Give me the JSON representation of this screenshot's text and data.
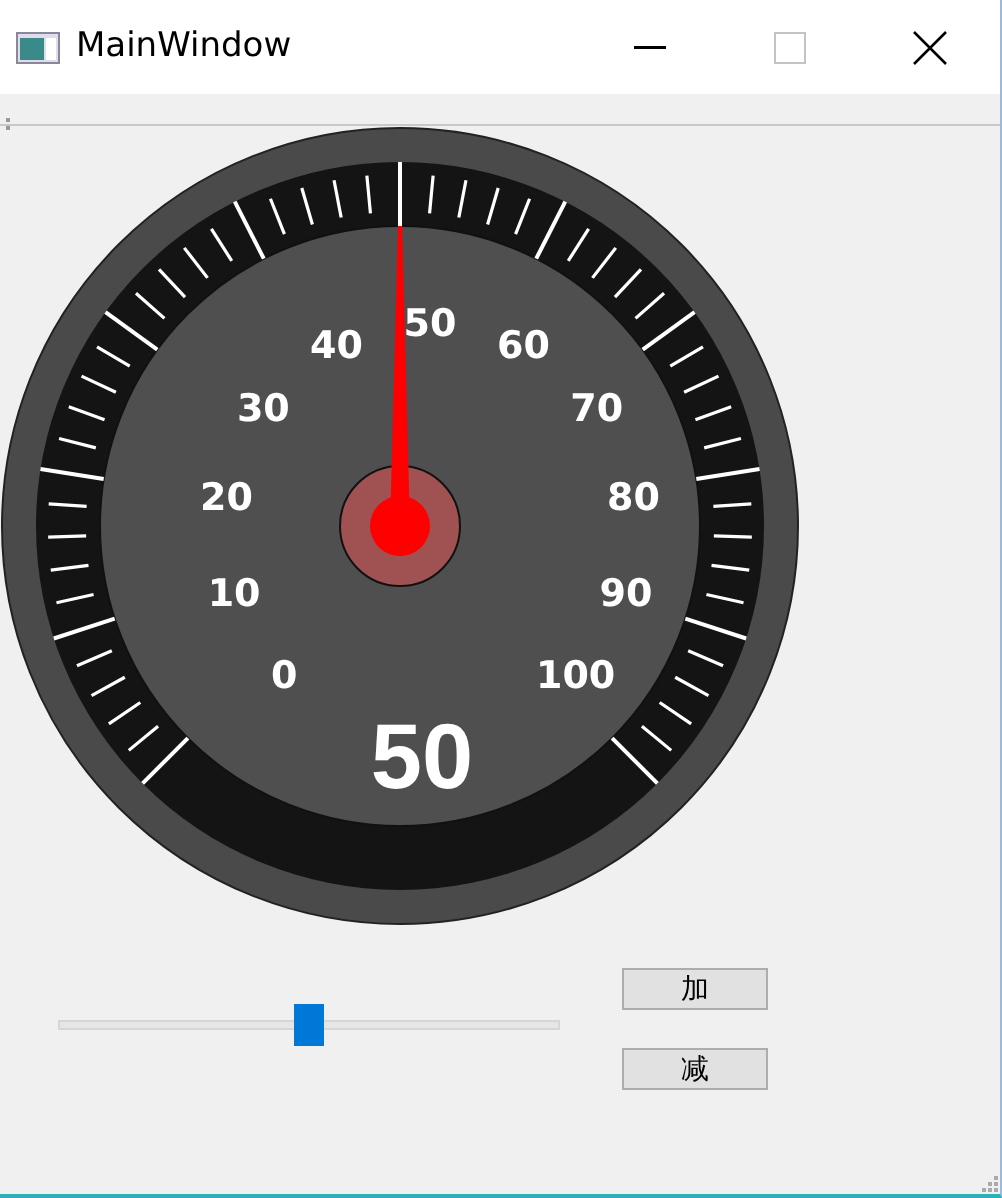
{
  "window": {
    "title": "MainWindow"
  },
  "gauge": {
    "scale_labels": [
      "0",
      "10",
      "20",
      "30",
      "40",
      "50",
      "60",
      "70",
      "80",
      "90",
      "100"
    ],
    "reading": "50"
  },
  "slider": {
    "level": 0.5
  },
  "buttons": [
    "加",
    "减"
  ]
}
